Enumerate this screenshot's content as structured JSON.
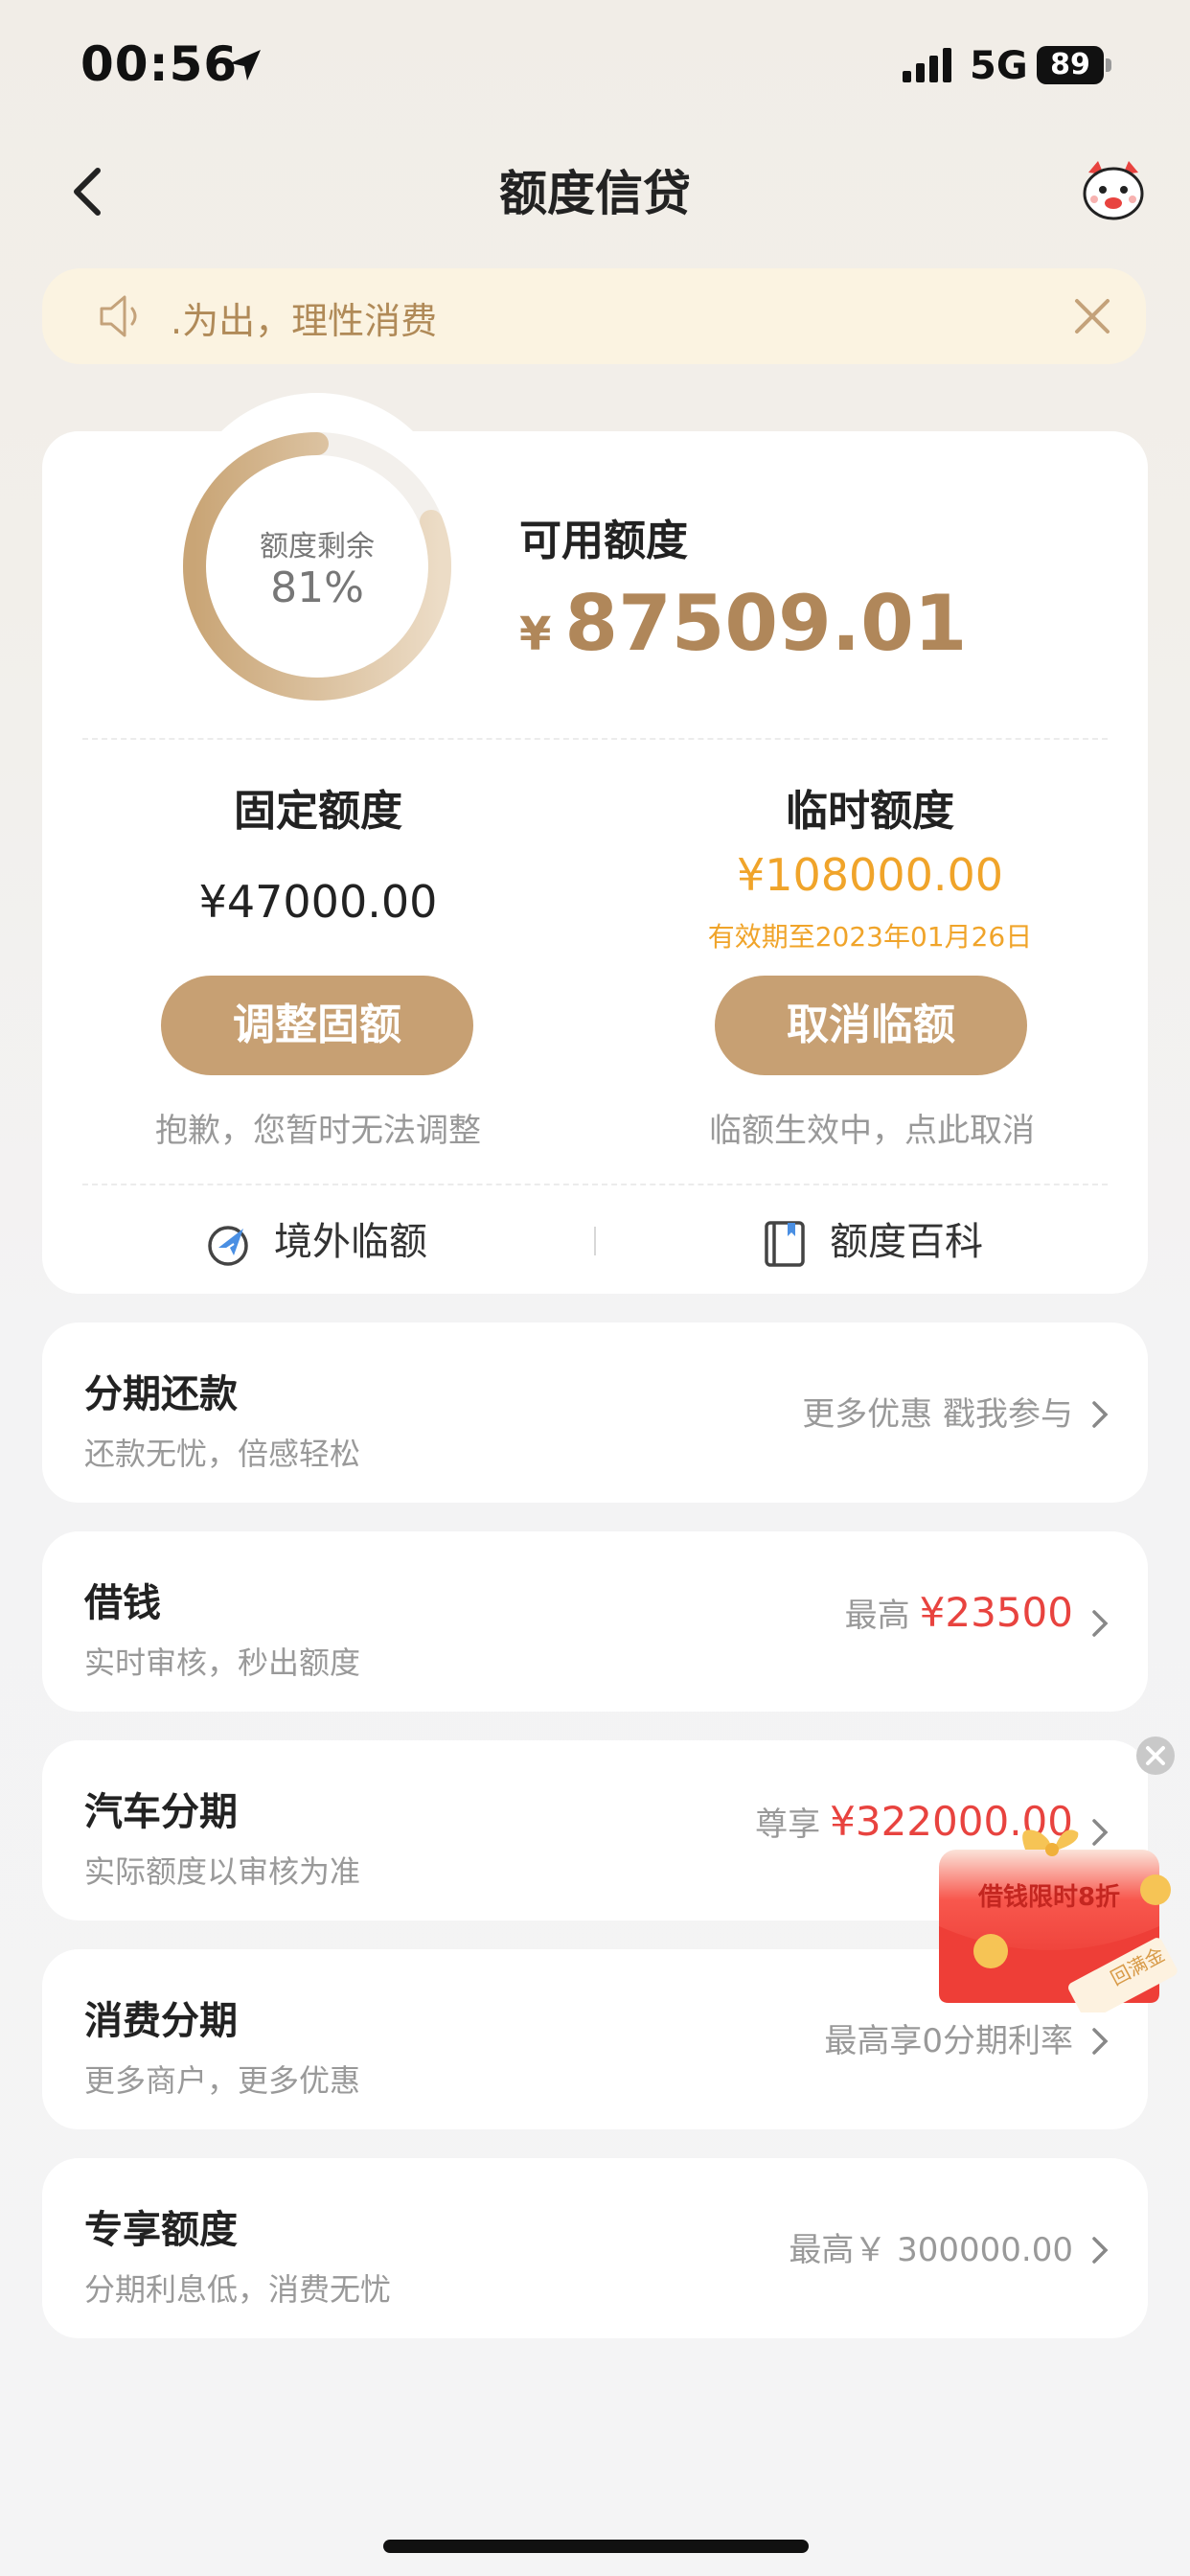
{
  "status": {
    "time": "00:56",
    "network": "5G",
    "battery": "89"
  },
  "nav": {
    "title": "额度信贷",
    "back_icon": "chevron-left-icon",
    "mascot_icon": "mascot-icon"
  },
  "notice": {
    "text": ".为出，理性消费"
  },
  "quota": {
    "ring_label": "额度剩余",
    "ring_value": "81%",
    "ring_fraction": 0.81,
    "available_label": "可用额度",
    "currency": "¥",
    "available_amount": "87509.01",
    "fixed": {
      "title": "固定额度",
      "amount": "¥47000.00",
      "button": "调整固额",
      "note": "抱歉，您暂时无法调整"
    },
    "temp": {
      "title": "临时额度",
      "amount": "¥108000.00",
      "validity": "有效期至2023年01月26日",
      "button": "取消临额",
      "note": "临额生效中，点此取消"
    },
    "links": {
      "overseas": "境外临额",
      "wiki": "额度百科"
    }
  },
  "list": [
    {
      "title": "分期还款",
      "subtitle": "还款无忧，倍感轻松",
      "right_text": "更多优惠 戳我参与",
      "right_amount": ""
    },
    {
      "title": "借钱",
      "subtitle": "实时审核，秒出额度",
      "right_text": "最高",
      "right_amount": "¥23500"
    },
    {
      "title": "汽车分期",
      "subtitle": "实际额度以审核为准",
      "right_text": "尊享",
      "right_amount": "¥322000.00"
    },
    {
      "title": "消费分期",
      "subtitle": "更多商户，更多优惠",
      "right_text": "最高享0分期利率",
      "right_amount": ""
    },
    {
      "title": "专享额度",
      "subtitle": "分期利息低，消费无忧",
      "right_text": "最高￥ 300000.00",
      "right_amount": ""
    }
  ],
  "promo": {
    "text": "借钱限时8折",
    "ticket_text": "回满金"
  },
  "colors": {
    "accent": "#c7a073",
    "gold_text": "#b0875a",
    "temp_orange": "#f0a42a",
    "red": "#e8433f"
  }
}
